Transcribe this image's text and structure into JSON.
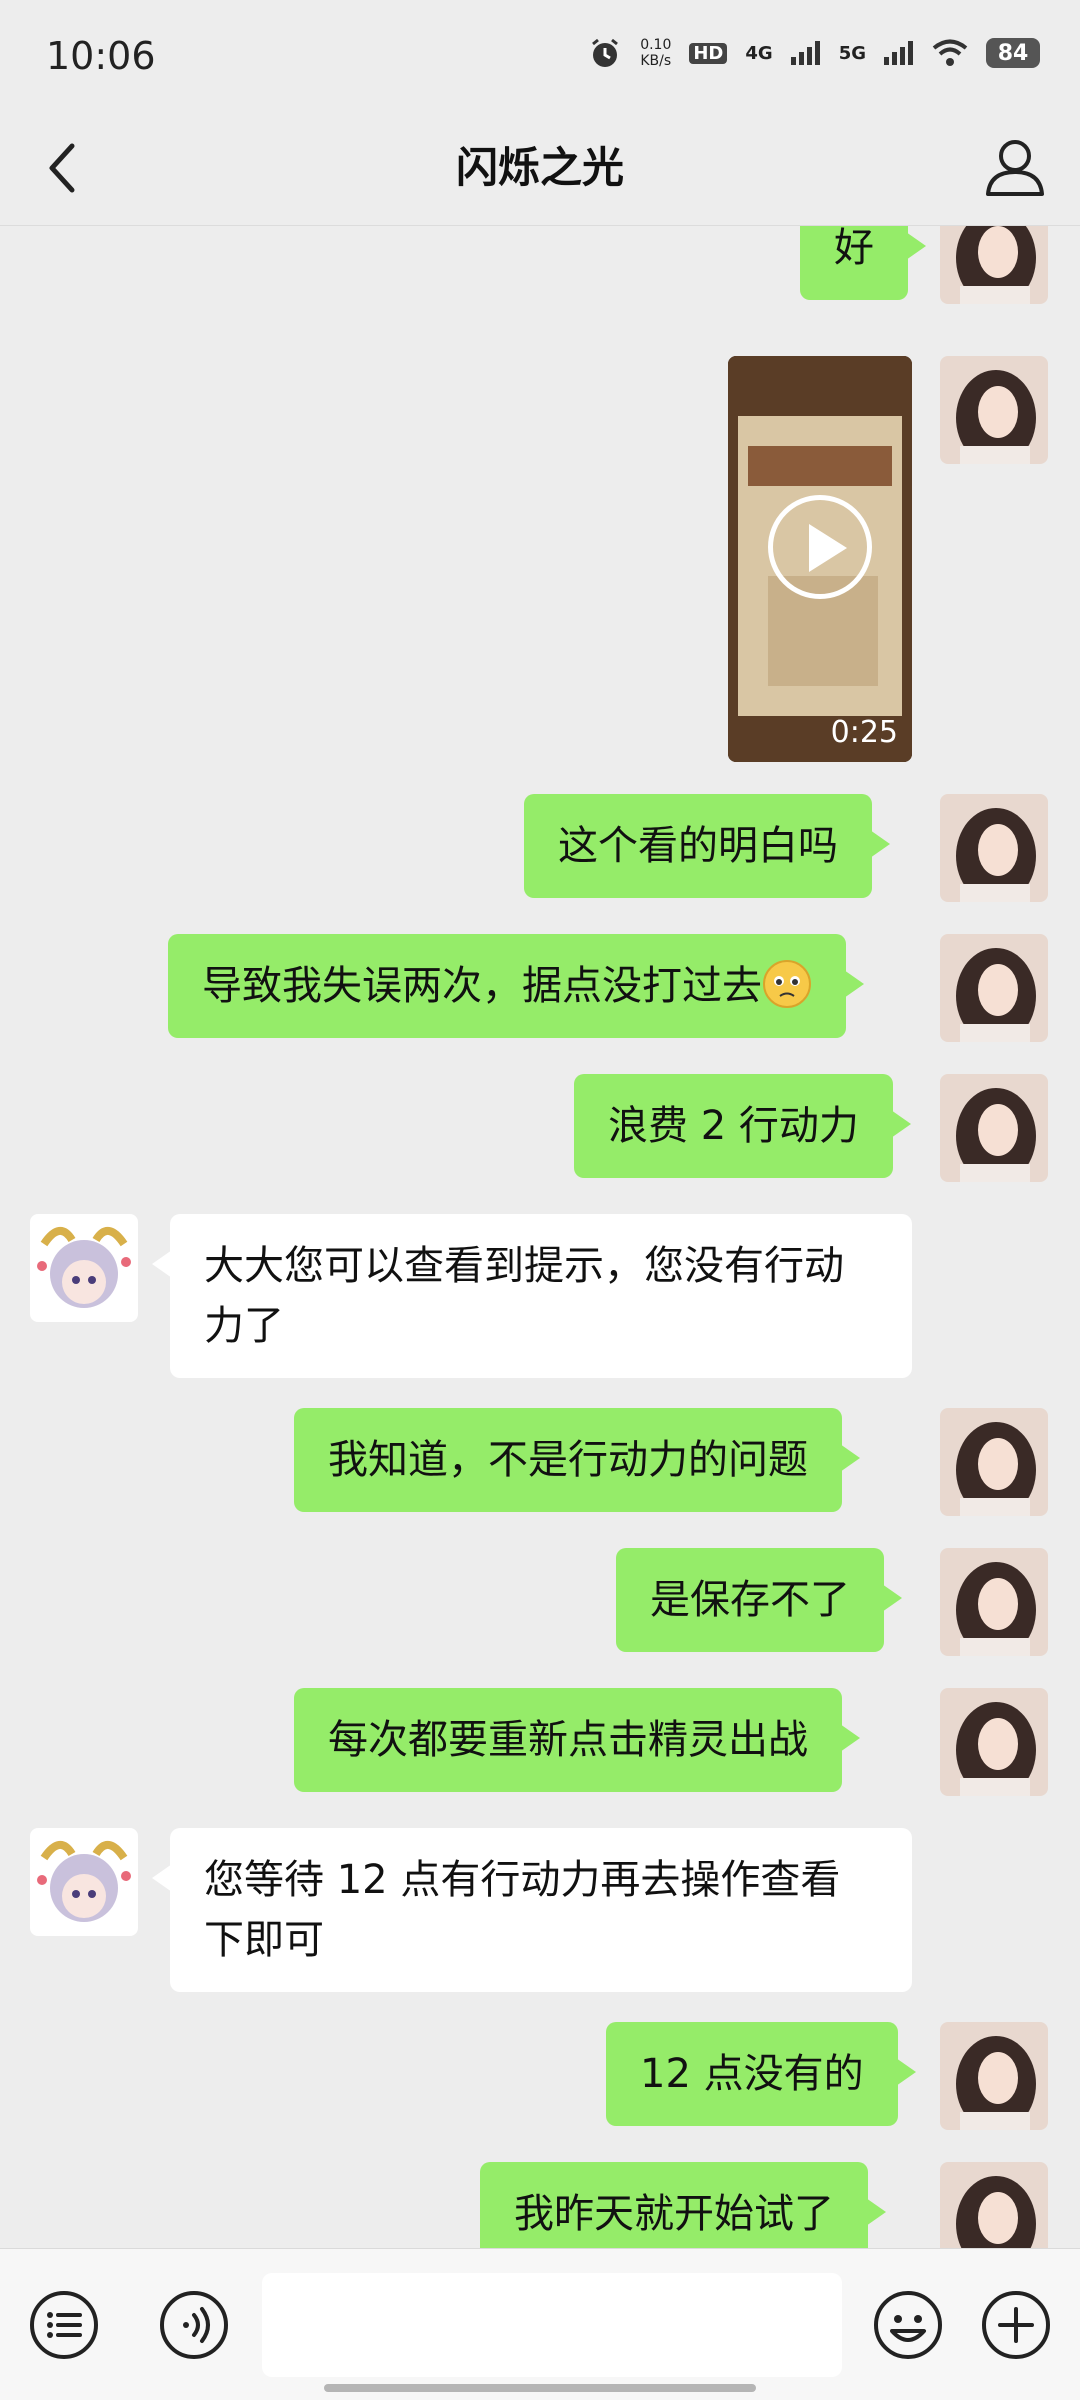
{
  "status_bar": {
    "time": "10:06",
    "net_speed_value": "0.10",
    "net_speed_unit": "KB/s",
    "hd": "HD",
    "sim1": "4G",
    "sim2": "5G",
    "battery": "84",
    "icons": [
      "alarm-icon",
      "signal-icon",
      "wifi-icon",
      "battery-icon"
    ]
  },
  "header": {
    "title": "闪烁之光",
    "back_icon": "chevron-left-icon",
    "profile_icon": "user-icon"
  },
  "messages": [
    {
      "side": "right",
      "type": "text",
      "text": "好"
    },
    {
      "side": "right",
      "type": "video",
      "duration": "0:25"
    },
    {
      "side": "right",
      "type": "text",
      "text": "这个看的明白吗"
    },
    {
      "side": "right",
      "type": "text",
      "text": "导致我失误两次，据点没打过去",
      "emoji": "pleading-face-icon"
    },
    {
      "side": "right",
      "type": "text",
      "text": "浪费 2 行动力"
    },
    {
      "side": "left",
      "type": "text",
      "text": "大大您可以查看到提示，您没有行动力了"
    },
    {
      "side": "right",
      "type": "text",
      "text": "我知道，不是行动力的问题"
    },
    {
      "side": "right",
      "type": "text",
      "text": "是保存不了"
    },
    {
      "side": "right",
      "type": "text",
      "text": "每次都要重新点击精灵出战"
    },
    {
      "side": "left",
      "type": "text",
      "text": "您等待 12 点有行动力再去操作查看下即可"
    },
    {
      "side": "right",
      "type": "text",
      "text": "12 点没有的"
    },
    {
      "side": "right",
      "type": "text",
      "text": "我昨天就开始试了"
    }
  ],
  "input_bar": {
    "menu_icon": "menu-list-icon",
    "voice_icon": "voice-icon",
    "emoji_icon": "emoji-icon",
    "add_icon": "plus-icon",
    "input_value": ""
  },
  "colors": {
    "bg": "#ededed",
    "outgoing_bubble": "#95ec69",
    "incoming_bubble": "#ffffff"
  }
}
